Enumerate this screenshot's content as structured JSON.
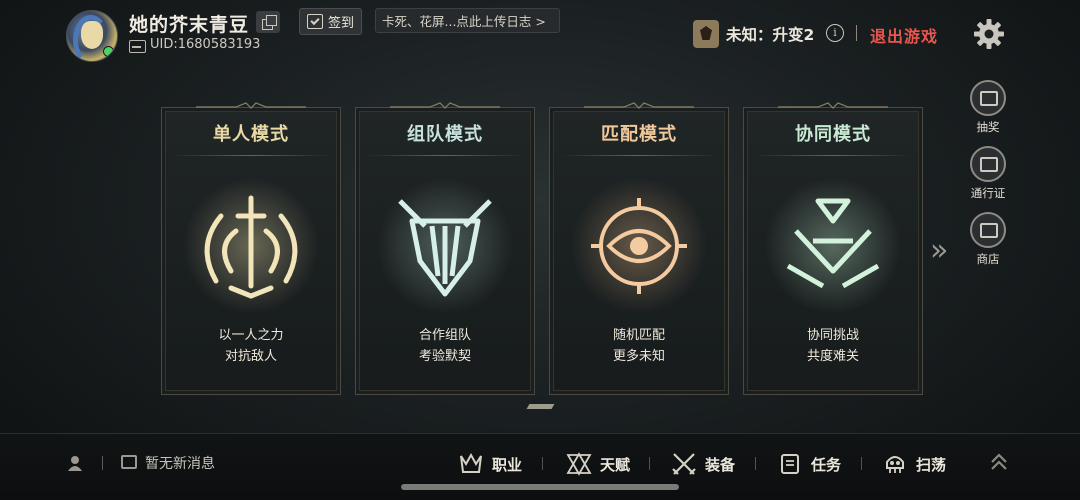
{
  "header": {
    "username": "她的芥末青豆",
    "uid": "UID:1680583193",
    "checkin_label": "签到",
    "notice_text": "卡死、花屏...点此上传日志 >",
    "rank_text": "未知：升变2",
    "info_glyph": "i",
    "exit_label": "退出游戏"
  },
  "side_menu": [
    {
      "label": "抽奖",
      "icon": "gacha-icon"
    },
    {
      "label": "通行证",
      "icon": "pass-icon"
    },
    {
      "label": "商店",
      "icon": "shop-icon"
    }
  ],
  "modes": [
    {
      "title": "单人模式",
      "line1": "以一人之力",
      "line2": "对抗敌人",
      "color": "#e8d9a6"
    },
    {
      "title": "组队模式",
      "line1": "合作组队",
      "line2": "考验默契",
      "color": "#c5e2dc"
    },
    {
      "title": "匹配模式",
      "line1": "随机匹配",
      "line2": "更多未知",
      "color": "#f1c89c"
    },
    {
      "title": "协同模式",
      "line1": "协同挑战",
      "line2": "共度难关",
      "color": "#c8ead4"
    }
  ],
  "carousel_chevron": "»",
  "footer": {
    "message": "暂无新消息",
    "nav": [
      "职业",
      "天赋",
      "装备",
      "任务",
      "扫荡"
    ]
  },
  "colors": {
    "exit": "#e8574f",
    "online": "#4ed36a"
  }
}
